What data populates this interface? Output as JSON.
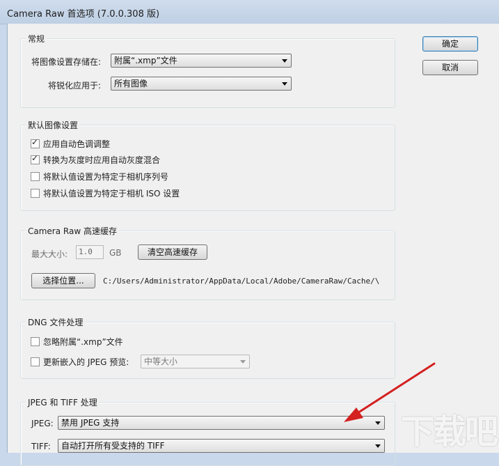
{
  "window": {
    "title": "Camera Raw 首选项 (7.0.0.308 版)"
  },
  "buttons": {
    "ok": "确定",
    "cancel": "取消"
  },
  "general": {
    "legend": "常规",
    "save_label": "将图像设置存储在:",
    "save_value": "附属“.xmp”文件",
    "sharpen_label": "将锐化应用于:",
    "sharpen_value": "所有图像"
  },
  "defaults": {
    "legend": "默认图像设置",
    "items": [
      {
        "label": "应用自动色调调整",
        "checked": true
      },
      {
        "label": "转换为灰度时应用自动灰度混合",
        "checked": true
      },
      {
        "label": "将默认值设置为特定于相机序列号",
        "checked": false
      },
      {
        "label": "将默认值设置为特定于相机 ISO 设置",
        "checked": false
      }
    ]
  },
  "cache": {
    "legend": "Camera Raw 高速缓存",
    "max_label": "最大大小:",
    "max_value": "1.0",
    "unit": "GB",
    "purge_label": "清空高速缓存",
    "location_label": "选择位置...",
    "path": "C:/Users/Administrator/AppData/Local/Adobe/CameraRaw/Cache/\\"
  },
  "dng": {
    "legend": "DNG 文件处理",
    "ignore_label": "忽略附属“.xmp”文件",
    "update_label": "更新嵌入的 JPEG 预览:",
    "preview_value": "中等大小"
  },
  "jpeg_tiff": {
    "legend": "JPEG 和 TIFF 处理",
    "jpeg_label": "JPEG:",
    "jpeg_value": "禁用 JPEG 支持",
    "tiff_label": "TIFF:",
    "tiff_value": "自动打开所有受支持的 TIFF"
  },
  "watermark": "下载吧",
  "colors": {
    "annotation_arrow": "#d42020",
    "default_button_border": "#3c7fb1"
  }
}
